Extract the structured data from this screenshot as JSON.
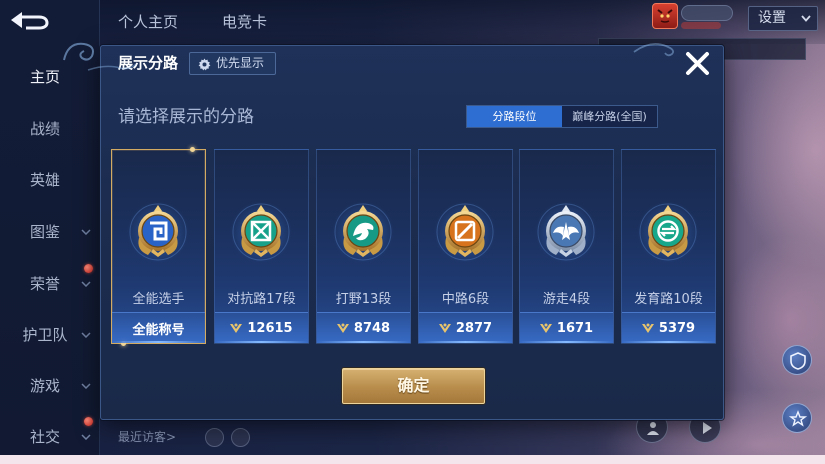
{
  "theme": {
    "accent_blue": "#2e6dd2",
    "selected_gold": "#d3ab63",
    "modal_bg": "#1b2c50",
    "confirm_gold": "#b88d4c"
  },
  "header": {
    "tabs": [
      "个人主页",
      "电竞卡"
    ],
    "settings_label": "设置",
    "settings_icon": "chevron-down-icon"
  },
  "sidebar": {
    "back_icon": "back-arrow-icon",
    "items": [
      {
        "label": "主页",
        "active": true
      },
      {
        "label": "战绩"
      },
      {
        "label": "英雄"
      },
      {
        "label": "图鉴",
        "expandable": true
      },
      {
        "label": "荣誉",
        "expandable": true,
        "badge": true
      },
      {
        "label": "护卫队",
        "expandable": true
      },
      {
        "label": "游戏",
        "expandable": true
      },
      {
        "label": "社交",
        "expandable": true,
        "badge": true
      }
    ]
  },
  "visitors": {
    "label": "最近访客>"
  },
  "modal": {
    "title": "展示分路",
    "priority_button": {
      "label": "优先显示",
      "icon": "gear-icon"
    },
    "close_icon": "close-icon",
    "prompt": "请选择展示的分路",
    "toggle": [
      {
        "label": "分路段位",
        "active": true
      },
      {
        "label": "巅峰分路(全国)",
        "active": false
      }
    ],
    "cards": [
      {
        "icon": "all-round-emblem-icon",
        "rank": "全能选手",
        "value": "全能称号",
        "selected": true
      },
      {
        "icon": "clash-lane-emblem-icon",
        "rank": "对抗路17段",
        "value": "12615",
        "value_icon": "peak-points-icon"
      },
      {
        "icon": "jungle-emblem-icon",
        "rank": "打野13段",
        "value": "8748",
        "value_icon": "peak-points-icon"
      },
      {
        "icon": "mid-lane-emblem-icon",
        "rank": "中路6段",
        "value": "2877",
        "value_icon": "peak-points-icon"
      },
      {
        "icon": "roam-emblem-icon",
        "rank": "游走4段",
        "value": "1671",
        "value_icon": "peak-points-icon"
      },
      {
        "icon": "farm-lane-emblem-icon",
        "rank": "发育路10段",
        "value": "5379",
        "value_icon": "peak-points-icon"
      }
    ],
    "confirm_label": "确定"
  }
}
